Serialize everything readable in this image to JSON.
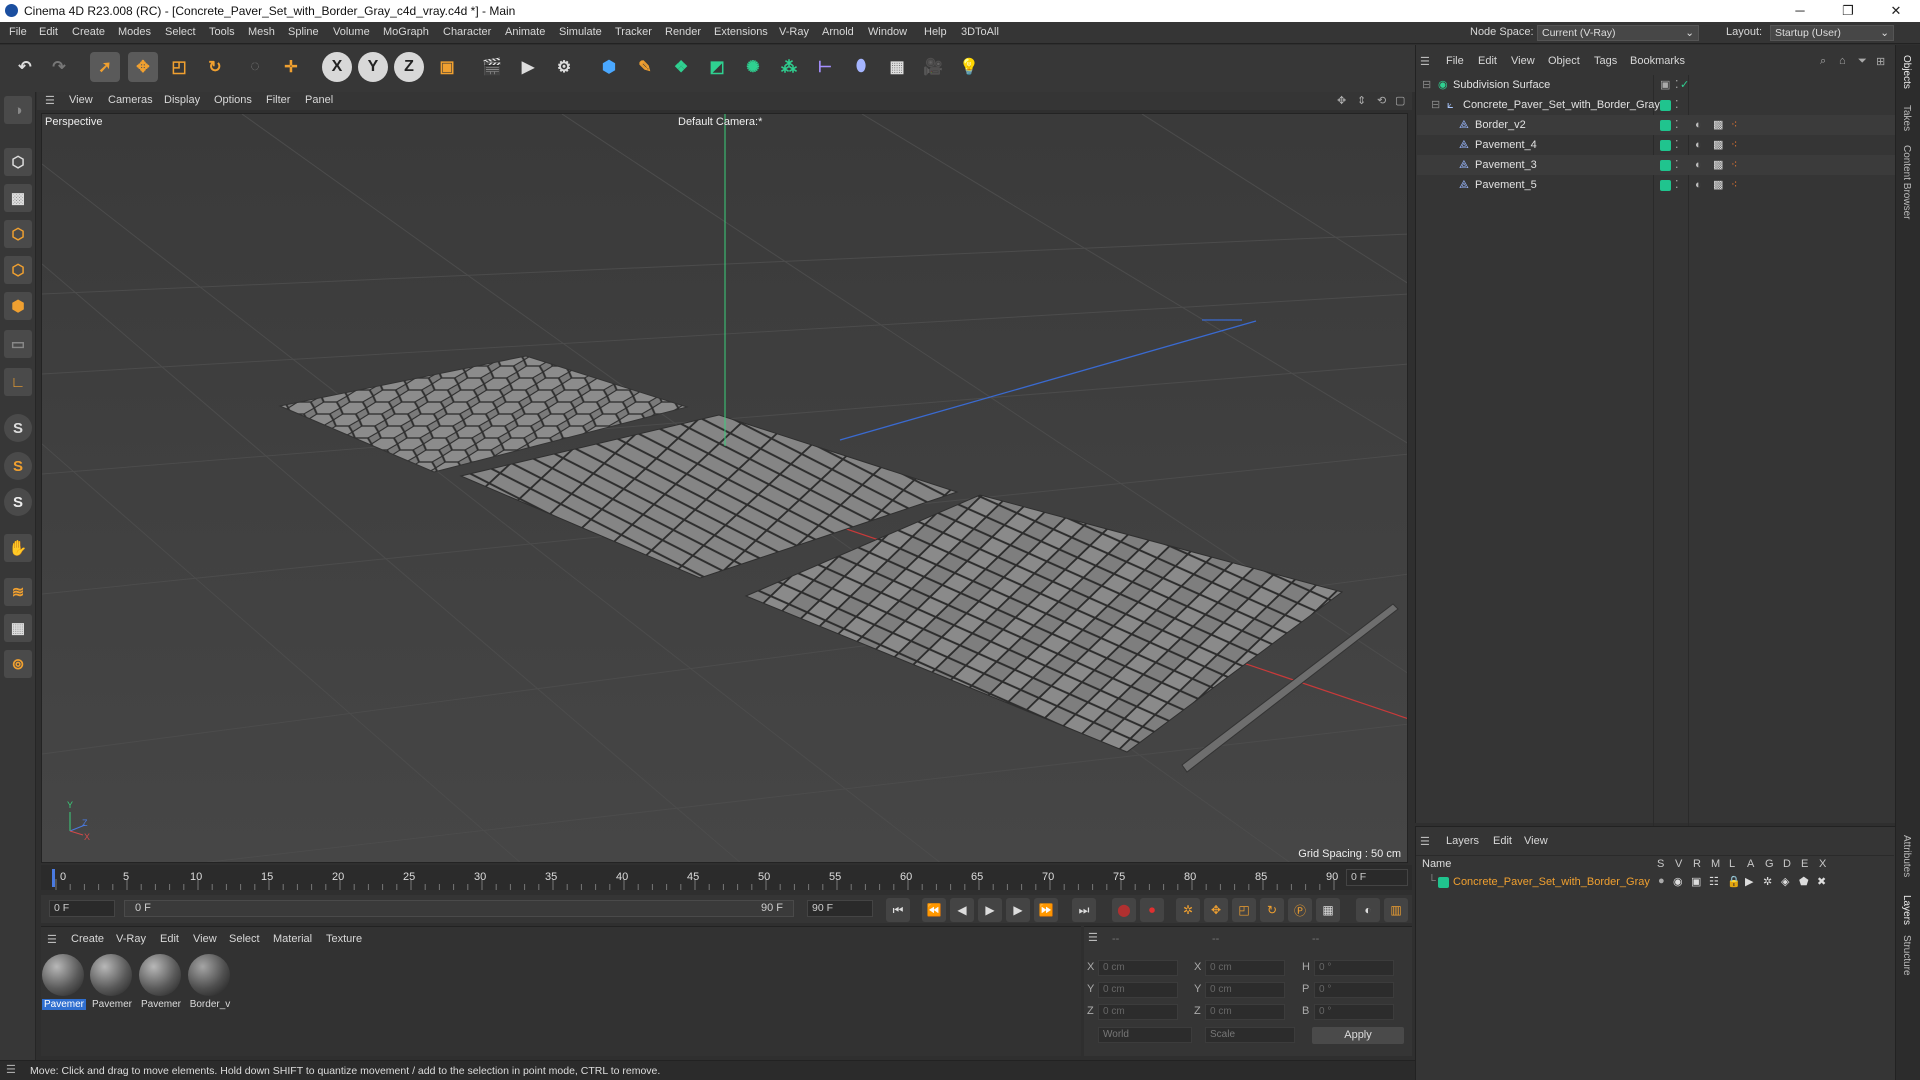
{
  "titlebar": {
    "title": "Cinema 4D R23.008 (RC) - [Concrete_Paver_Set_with_Border_Gray_c4d_vray.c4d *] - Main",
    "minimize": "─",
    "maximize": "❐",
    "close": "✕"
  },
  "menubar": {
    "items": [
      "File",
      "Edit",
      "Create",
      "Modes",
      "Select",
      "Tools",
      "Mesh",
      "Spline",
      "Volume",
      "MoGraph",
      "Character",
      "Animate",
      "Simulate",
      "Tracker",
      "Render",
      "Extensions",
      "V-Ray",
      "Arnold",
      "Window",
      "Help",
      "3DToAll"
    ],
    "node_space_label": "Node Space:",
    "node_space_value": "Current (V-Ray)",
    "layout_label": "Layout:",
    "layout_value": "Startup (User)"
  },
  "toolbar": {
    "axis_x": "X",
    "axis_y": "Y",
    "axis_z": "Z"
  },
  "viewport": {
    "menu": [
      "View",
      "Cameras",
      "Display",
      "Options",
      "Filter",
      "Panel"
    ],
    "label": "Perspective",
    "camera": "Default Camera",
    "camera_suffix": ":*",
    "grid_spacing": "Grid Spacing : 50 cm",
    "axis_y": "Y",
    "axis_z": "Z",
    "axis_x": "X"
  },
  "timeline": {
    "ticks": [
      "0",
      "5",
      "10",
      "15",
      "20",
      "25",
      "30",
      "35",
      "40",
      "45",
      "50",
      "55",
      "60",
      "65",
      "70",
      "75",
      "80",
      "85",
      "90"
    ],
    "current_frame": "0 F"
  },
  "transport": {
    "start": "0 F",
    "range_start": "0 F",
    "range_end": "90 F",
    "end": "90 F"
  },
  "materials": {
    "menu": [
      "Create",
      "V-Ray",
      "Edit",
      "View",
      "Select",
      "Material",
      "Texture"
    ],
    "items": [
      "Pavemer",
      "Pavemer",
      "Pavemer",
      "Border_v"
    ]
  },
  "coords": {
    "headers": [
      "--",
      "--",
      "--"
    ],
    "labels_left": [
      "X",
      "Y",
      "Z"
    ],
    "labels_mid": [
      "X",
      "Y",
      "Z"
    ],
    "labels_right": [
      "H",
      "P",
      "B"
    ],
    "pos": [
      "0 cm",
      "0 cm",
      "0 cm"
    ],
    "size": [
      "0 cm",
      "0 cm",
      "0 cm"
    ],
    "rot": [
      "0 °",
      "0 °",
      "0 °"
    ],
    "world": "World",
    "scale": "Scale",
    "apply": "Apply"
  },
  "status": {
    "text": "Move: Click and drag to move elements. Hold down SHIFT to quantize movement / add to the selection in point mode, CTRL to remove."
  },
  "objects": {
    "menu": [
      "File",
      "Edit",
      "View",
      "Object",
      "Tags",
      "Bookmarks"
    ],
    "rows": [
      {
        "name": "Subdivision Surface"
      },
      {
        "name": "Concrete_Paver_Set_with_Border_Gray"
      },
      {
        "name": "Border_v2"
      },
      {
        "name": "Pavement_4"
      },
      {
        "name": "Pavement_3"
      },
      {
        "name": "Pavement_5"
      }
    ]
  },
  "layers": {
    "menu": [
      "Layers",
      "Edit",
      "View"
    ],
    "name_header": "Name",
    "flag_headers": [
      "S",
      "V",
      "R",
      "M",
      "L",
      "A",
      "G",
      "D",
      "E",
      "X"
    ],
    "layer_name": "Concrete_Paver_Set_with_Border_Gray",
    "layer_color": "#20c48e"
  },
  "right_tabs": [
    "Objects",
    "Takes",
    "Content Browser",
    "Attributes",
    "Layers",
    "Structure"
  ],
  "colors": {
    "accent_green": "#20c48e",
    "axis_red": "#c83a3a",
    "axis_blue": "#3a6ad0",
    "axis_green": "#3acf7a",
    "selected_blue": "#2f6fd0"
  }
}
